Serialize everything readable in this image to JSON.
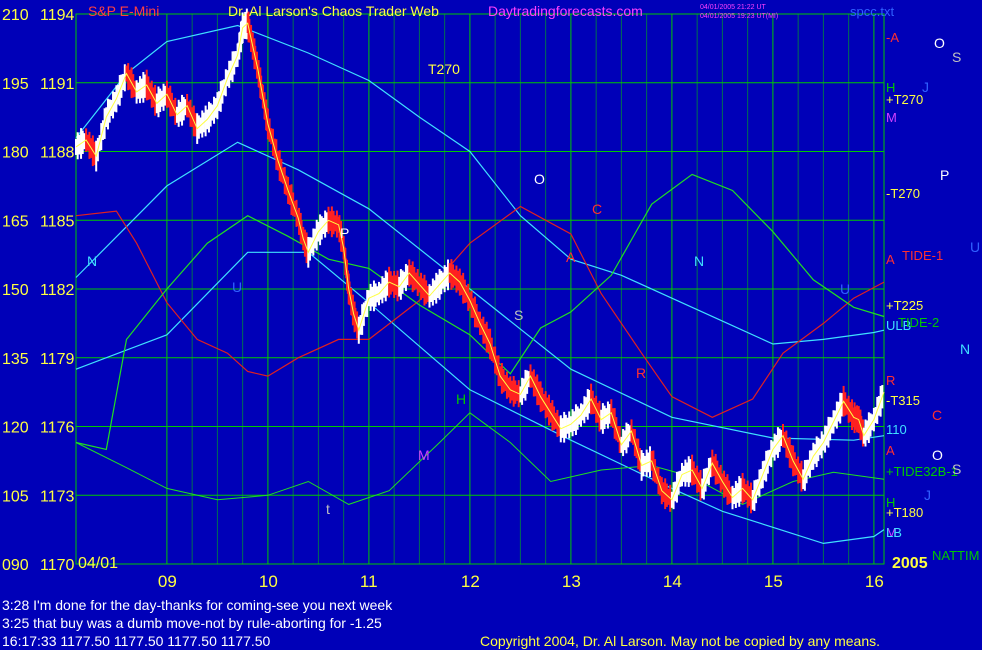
{
  "window": {
    "title_left": "S&P E-Mini",
    "title_center": "Dr. Al Larson's Chaos Trader Web",
    "title_site": "Daytradingforecasts.com",
    "stamp_line1": "04/01/2005 21:22 UT",
    "stamp_line2": "04/01/2005 19:23 UT(MI)",
    "file_name": "spcc.txt",
    "copyright": "Copyright 2004, Dr. Al Larson. May not be copied by any means."
  },
  "footer": {
    "notes": [
      "3:28 I'm done for the day-thanks for coming-see you next week",
      "3:25 that buy was a dumb move-not by rule-aborting for -1.25"
    ],
    "quote": "16:17:33   1177.50 1177.50 1177.50 1177.50"
  },
  "chart_data": {
    "type": "line",
    "title": "S&P E-Mini",
    "date_label": "04/01",
    "year_label": "2005",
    "x_ticks": [
      "09",
      "10",
      "11",
      "12",
      "13",
      "14",
      "15",
      "16"
    ],
    "y_ticks_left": [
      "210",
      "195",
      "180",
      "165",
      "150",
      "135",
      "120",
      "105",
      "090"
    ],
    "y_ticks_price": [
      "1194",
      "1191",
      "1188",
      "1185",
      "1182",
      "1179",
      "1176",
      "1173",
      "1170"
    ],
    "ylim": [
      1170,
      1194
    ],
    "xlim": [
      8.1,
      16.1
    ],
    "price": [
      [
        8.1,
        1188.2
      ],
      [
        8.2,
        1188.5
      ],
      [
        8.3,
        1187.8
      ],
      [
        8.4,
        1189.5
      ],
      [
        8.5,
        1190.3
      ],
      [
        8.6,
        1191.4
      ],
      [
        8.7,
        1190.6
      ],
      [
        8.8,
        1190.9
      ],
      [
        8.9,
        1190.1
      ],
      [
        9.0,
        1190.5
      ],
      [
        9.1,
        1189.6
      ],
      [
        9.2,
        1190.0
      ],
      [
        9.3,
        1189.0
      ],
      [
        9.4,
        1189.4
      ],
      [
        9.5,
        1190.0
      ],
      [
        9.6,
        1191.2
      ],
      [
        9.7,
        1192.2
      ],
      [
        9.75,
        1193.4
      ],
      [
        9.8,
        1193.6
      ],
      [
        9.85,
        1192.6
      ],
      [
        9.9,
        1191.6
      ],
      [
        9.95,
        1190.4
      ],
      [
        10.0,
        1189.2
      ],
      [
        10.1,
        1187.6
      ],
      [
        10.2,
        1186.3
      ],
      [
        10.3,
        1185.1
      ],
      [
        10.35,
        1184.2
      ],
      [
        10.4,
        1183.6
      ],
      [
        10.5,
        1184.5
      ],
      [
        10.6,
        1185.0
      ],
      [
        10.7,
        1184.8
      ],
      [
        10.75,
        1183.8
      ],
      [
        10.8,
        1182.0
      ],
      [
        10.85,
        1180.9
      ],
      [
        10.9,
        1180.2
      ],
      [
        11.0,
        1181.6
      ],
      [
        11.1,
        1181.8
      ],
      [
        11.2,
        1182.3
      ],
      [
        11.3,
        1182.1
      ],
      [
        11.4,
        1182.7
      ],
      [
        11.5,
        1182.2
      ],
      [
        11.6,
        1181.7
      ],
      [
        11.7,
        1182.2
      ],
      [
        11.8,
        1182.7
      ],
      [
        11.9,
        1182.3
      ],
      [
        12.0,
        1181.5
      ],
      [
        12.1,
        1180.5
      ],
      [
        12.2,
        1179.6
      ],
      [
        12.3,
        1178.2
      ],
      [
        12.4,
        1177.6
      ],
      [
        12.5,
        1177.4
      ],
      [
        12.6,
        1178.2
      ],
      [
        12.7,
        1177.3
      ],
      [
        12.8,
        1176.6
      ],
      [
        12.9,
        1175.9
      ],
      [
        13.0,
        1176.1
      ],
      [
        13.1,
        1176.5
      ],
      [
        13.2,
        1177.2
      ],
      [
        13.3,
        1176.3
      ],
      [
        13.4,
        1176.6
      ],
      [
        13.5,
        1175.2
      ],
      [
        13.6,
        1175.8
      ],
      [
        13.7,
        1174.3
      ],
      [
        13.8,
        1174.5
      ],
      [
        13.9,
        1173.2
      ],
      [
        14.0,
        1172.8
      ],
      [
        14.1,
        1173.9
      ],
      [
        14.2,
        1174.1
      ],
      [
        14.3,
        1173.3
      ],
      [
        14.4,
        1174.4
      ],
      [
        14.5,
        1173.6
      ],
      [
        14.6,
        1172.9
      ],
      [
        14.7,
        1173.3
      ],
      [
        14.8,
        1172.8
      ],
      [
        14.9,
        1173.9
      ],
      [
        15.0,
        1175.0
      ],
      [
        15.1,
        1175.6
      ],
      [
        15.2,
        1174.5
      ],
      [
        15.3,
        1173.7
      ],
      [
        15.4,
        1174.7
      ],
      [
        15.5,
        1175.3
      ],
      [
        15.6,
        1176.2
      ],
      [
        15.7,
        1177.1
      ],
      [
        15.8,
        1176.4
      ],
      [
        15.85,
        1176.3
      ],
      [
        15.9,
        1175.6
      ],
      [
        16.0,
        1176.3
      ],
      [
        16.1,
        1177.5
      ]
    ],
    "lower_band": [
      [
        8.1,
        1178.5
      ],
      [
        9.0,
        1180.0
      ],
      [
        9.8,
        1183.6
      ],
      [
        10.4,
        1183.6
      ],
      [
        11.0,
        1181.4
      ],
      [
        12.0,
        1177.6
      ],
      [
        13.0,
        1175.4
      ],
      [
        14.0,
        1173.3
      ],
      [
        14.5,
        1172.3
      ],
      [
        15.0,
        1171.6
      ],
      [
        15.5,
        1170.9
      ],
      [
        16.0,
        1171.2
      ],
      [
        16.1,
        1171.5
      ]
    ],
    "upper_band": [
      [
        8.1,
        1188.6
      ],
      [
        8.6,
        1191.4
      ],
      [
        9.0,
        1192.8
      ],
      [
        9.7,
        1193.5
      ],
      [
        10.4,
        1192.3
      ],
      [
        11.0,
        1191.1
      ],
      [
        11.5,
        1189.5
      ],
      [
        12.0,
        1188.0
      ],
      [
        12.5,
        1185.2
      ],
      [
        13.0,
        1183.3
      ],
      [
        13.5,
        1182.6
      ],
      [
        14.0,
        1181.6
      ],
      [
        14.5,
        1180.6
      ],
      [
        15.0,
        1179.6
      ],
      [
        15.5,
        1179.8
      ],
      [
        16.0,
        1180.1
      ],
      [
        16.1,
        1180.2
      ]
    ],
    "mid_band": [
      [
        8.1,
        1182.5
      ],
      [
        9.0,
        1186.5
      ],
      [
        9.7,
        1188.4
      ],
      [
        10.3,
        1187.2
      ],
      [
        11.0,
        1185.5
      ],
      [
        12.0,
        1182.0
      ],
      [
        13.0,
        1178.5
      ],
      [
        14.0,
        1176.4
      ],
      [
        15.0,
        1175.5
      ],
      [
        15.8,
        1175.4
      ],
      [
        16.1,
        1175.6
      ]
    ],
    "tide1_red": [
      [
        8.1,
        1185.2
      ],
      [
        8.5,
        1185.4
      ],
      [
        8.7,
        1184.0
      ],
      [
        9.0,
        1181.4
      ],
      [
        9.3,
        1179.8
      ],
      [
        9.6,
        1179.2
      ],
      [
        9.8,
        1178.4
      ],
      [
        10.0,
        1178.2
      ],
      [
        10.3,
        1179.0
      ],
      [
        10.7,
        1179.8
      ],
      [
        11.0,
        1179.8
      ],
      [
        11.5,
        1181.5
      ],
      [
        12.0,
        1184.0
      ],
      [
        12.5,
        1185.6
      ],
      [
        13.0,
        1184.4
      ],
      [
        13.3,
        1181.8
      ],
      [
        13.7,
        1179.2
      ],
      [
        14.0,
        1177.3
      ],
      [
        14.4,
        1176.4
      ],
      [
        14.8,
        1177.2
      ],
      [
        15.1,
        1179.2
      ],
      [
        15.5,
        1180.5
      ],
      [
        15.8,
        1181.6
      ],
      [
        16.1,
        1182.3
      ]
    ],
    "tide2_green": [
      [
        8.1,
        1175.3
      ],
      [
        8.4,
        1175.0
      ],
      [
        8.6,
        1179.8
      ],
      [
        9.0,
        1182.0
      ],
      [
        9.4,
        1184.0
      ],
      [
        9.8,
        1185.2
      ],
      [
        10.2,
        1184.3
      ],
      [
        10.6,
        1183.3
      ],
      [
        11.0,
        1182.9
      ],
      [
        11.5,
        1181.3
      ],
      [
        12.0,
        1180.0
      ],
      [
        12.4,
        1178.3
      ],
      [
        12.7,
        1180.3
      ],
      [
        13.0,
        1181.0
      ],
      [
        13.4,
        1182.6
      ],
      [
        13.8,
        1185.7
      ],
      [
        14.2,
        1187.0
      ],
      [
        14.6,
        1186.3
      ],
      [
        15.0,
        1184.5
      ],
      [
        15.4,
        1182.4
      ],
      [
        15.8,
        1181.2
      ],
      [
        16.1,
        1180.8
      ]
    ],
    "tide32b_green": [
      [
        8.1,
        1175.3
      ],
      [
        8.6,
        1174.2
      ],
      [
        9.0,
        1173.3
      ],
      [
        9.5,
        1172.8
      ],
      [
        10.0,
        1173.0
      ],
      [
        10.4,
        1173.6
      ],
      [
        10.8,
        1172.6
      ],
      [
        11.2,
        1173.2
      ],
      [
        11.7,
        1175.3
      ],
      [
        12.0,
        1176.6
      ],
      [
        12.4,
        1175.3
      ],
      [
        12.8,
        1173.6
      ],
      [
        13.3,
        1174.1
      ],
      [
        13.8,
        1174.3
      ],
      [
        14.2,
        1173.8
      ],
      [
        14.7,
        1172.6
      ],
      [
        15.2,
        1173.6
      ],
      [
        15.6,
        1174.0
      ],
      [
        16.1,
        1173.7
      ]
    ],
    "curve_labels": [
      {
        "text": "-A",
        "color": "#ff3030"
      },
      {
        "text": "H",
        "color": "#00c800"
      },
      {
        "text": "+T270",
        "color": "#ffff40"
      },
      {
        "text": "M",
        "color": "#d040ff"
      },
      {
        "text": "-T270",
        "color": "#ffff40"
      },
      {
        "text": "A",
        "color": "#ff3030"
      },
      {
        "text": "TIDE-1",
        "color": "#ff3030"
      },
      {
        "text": "+T225",
        "color": "#ffff40"
      },
      {
        "text": "ULB",
        "color": "#40e0ff"
      },
      {
        "text": "TIDE-2",
        "color": "#00c800"
      },
      {
        "text": "R",
        "color": "#ff3030"
      },
      {
        "text": "-T315",
        "color": "#ffff40"
      },
      {
        "text": "110",
        "color": "#40e0ff"
      },
      {
        "text": "A",
        "color": "#ff3030"
      },
      {
        "text": "+TIDE32B-1",
        "color": "#00c800"
      },
      {
        "text": "H",
        "color": "#00c800"
      },
      {
        "text": "+T180",
        "color": "#ffff40"
      },
      {
        "text": "M",
        "color": "#d040ff"
      },
      {
        "text": "LB",
        "color": "#40e0ff"
      },
      {
        "text": "NATTIM",
        "color": "#00c800"
      }
    ],
    "right_letters": [
      {
        "text": "O",
        "color": "#ffffff"
      },
      {
        "text": "S",
        "color": "#c0c0c0"
      },
      {
        "text": "J",
        "color": "#3060ff"
      },
      {
        "text": "P",
        "color": "#ffffff"
      },
      {
        "text": "U",
        "color": "#3060ff"
      },
      {
        "text": "N",
        "color": "#40e0ff"
      },
      {
        "text": "C",
        "color": "#ff3030"
      },
      {
        "text": "O",
        "color": "#ffffff"
      },
      {
        "text": "S",
        "color": "#c0c0c0"
      },
      {
        "text": "J",
        "color": "#3060ff"
      }
    ],
    "in_chart_labels": [
      {
        "text": "T270",
        "color": "#ffff40"
      },
      {
        "text": "N",
        "color": "#40e0ff"
      },
      {
        "text": "U",
        "color": "#3060ff"
      },
      {
        "text": "P",
        "color": "#ffffff"
      },
      {
        "text": "O",
        "color": "#ffffff"
      },
      {
        "text": "C",
        "color": "#ff3030"
      },
      {
        "text": "A",
        "color": "#ff3030"
      },
      {
        "text": "S",
        "color": "#c0c0c0"
      },
      {
        "text": "H",
        "color": "#00c800"
      },
      {
        "text": "R",
        "color": "#ff3030"
      },
      {
        "text": "N",
        "color": "#40e0ff"
      },
      {
        "text": "M",
        "color": "#d040ff"
      },
      {
        "text": "t",
        "color": "#c0c0c0"
      },
      {
        "text": "U",
        "color": "#3060ff"
      }
    ],
    "colors": {
      "background": "#0000b8",
      "grid": "#00c800",
      "price_bar": "#ffffff",
      "price_down": "#ff2020",
      "avg": "#ffff40",
      "band": "#40e0ff",
      "tide1": "#e02020",
      "tide2": "#20e020"
    }
  }
}
